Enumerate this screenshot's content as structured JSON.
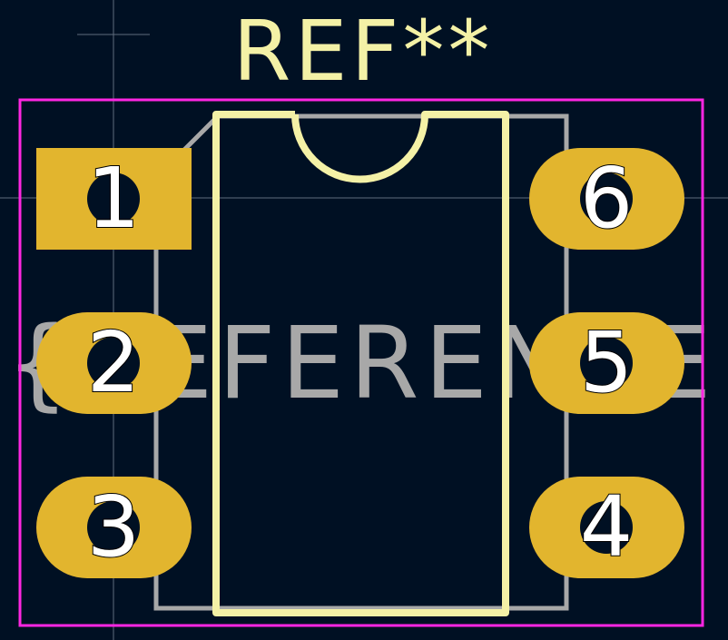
{
  "footprint": {
    "reference": "REF**",
    "value": "${REFERENCE}",
    "pads": [
      {
        "number": "1",
        "shape": "rect"
      },
      {
        "number": "2",
        "shape": "oval"
      },
      {
        "number": "3",
        "shape": "oval"
      },
      {
        "number": "4",
        "shape": "oval"
      },
      {
        "number": "5",
        "shape": "oval"
      },
      {
        "number": "6",
        "shape": "oval"
      }
    ]
  },
  "colors": {
    "background": "#001023",
    "pad": "#e2b52e",
    "silkscreen": "#f4f1a6",
    "fab": "#a8a8a8",
    "courtyard": "#ff26e2",
    "crosshair": "#8a93a3"
  }
}
